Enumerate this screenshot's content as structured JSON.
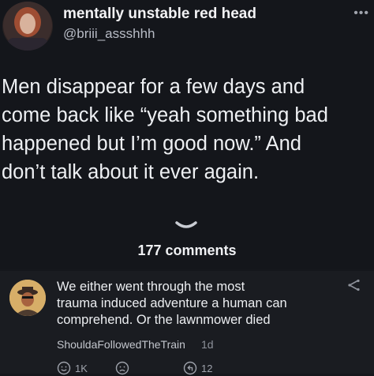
{
  "post": {
    "author_name": "mentally unstable red head",
    "author_handle": "@briii_assshhh",
    "text": "Men disappear for a few days and\ncome back like “yeah something bad\nhappened but I’m good now.” And\ndon’t talk about it ever again.",
    "more_icon": "more-icon"
  },
  "comments_label": "177 comments",
  "comment": {
    "text": "We either went through the most\ntrauma induced adventure a human can\ncomprehend. Or the lawnmower died",
    "author": "ShouldaFollowedTheTrain",
    "time": "1d",
    "like_count": "1K",
    "reply_count": "12"
  },
  "icons": [
    "more-icon",
    "chevron-down-icon",
    "share-icon",
    "like-icon",
    "dislike-icon",
    "reply-icon"
  ]
}
